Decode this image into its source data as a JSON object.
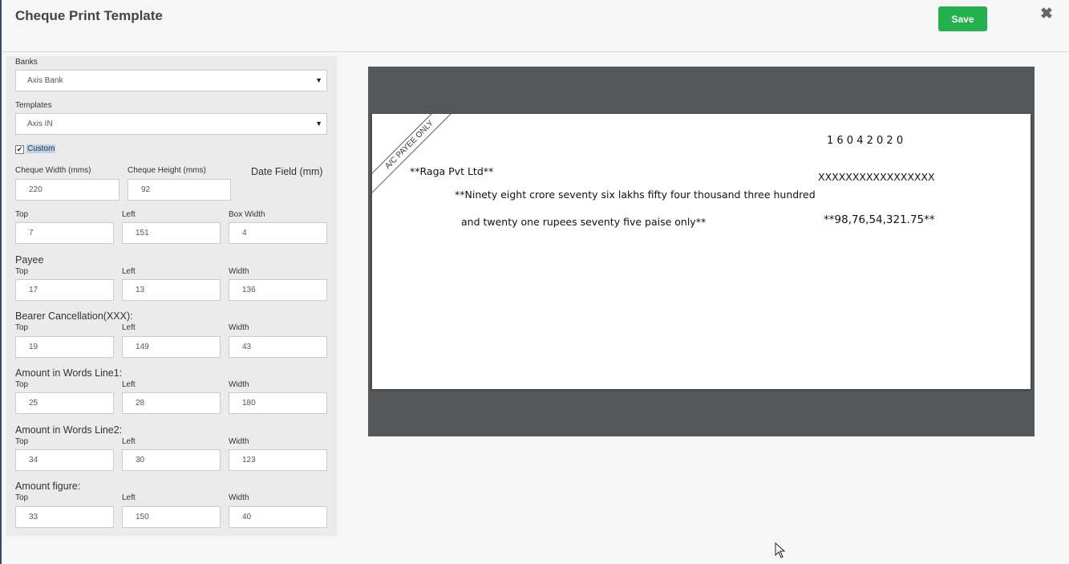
{
  "header": {
    "title": "Cheque Print Template",
    "save_label": "Save",
    "close_icon": "✖"
  },
  "form": {
    "banks_label": "Banks",
    "bank_value": "Axis Bank",
    "templates_label": "Templates",
    "template_value": "Axis IN",
    "custom_label": "Custom",
    "custom_checked": true,
    "width_label": "Cheque Width (mms)",
    "width_value": "220",
    "height_label": "Cheque Height (mms)",
    "height_value": "92",
    "date_heading": "Date Field (mm)",
    "date": {
      "top_label": "Top",
      "top": "7",
      "left_label": "Left",
      "left": "151",
      "box_label": "Box Width",
      "box": "4"
    },
    "payee": {
      "heading": "Payee",
      "top_label": "Top",
      "top": "17",
      "left_label": "Left",
      "left": "13",
      "width_label": "Width",
      "width": "136"
    },
    "bearer": {
      "heading": "Bearer Cancellation(XXX):",
      "top_label": "Top",
      "top": "19",
      "left_label": "Left",
      "left": "149",
      "width_label": "Width",
      "width": "43"
    },
    "words1": {
      "heading": "Amount in Words Line1:",
      "top_label": "Top",
      "top": "25",
      "left_label": "Left",
      "left": "28",
      "width_label": "Width",
      "width": "180"
    },
    "words2": {
      "heading": "Amount in Words Line2:",
      "top_label": "Top",
      "top": "34",
      "left_label": "Left",
      "left": "30",
      "width_label": "Width",
      "width": "123"
    },
    "figure": {
      "heading": "Amount figure:",
      "top_label": "Top",
      "top": "33",
      "left_label": "Left",
      "left": "150",
      "width_label": "Width",
      "width": "40"
    }
  },
  "cheque": {
    "ribbon": "A/C PAYEE ONLY",
    "date": "1 6 0 4 2 0 2 0",
    "payee": "**Raga Pvt Ltd**",
    "bearer": "XXXXXXXXXXXXXXXXX",
    "words_line1": "**Ninety eight crore seventy six lakhs fifty four thousand three hundred",
    "words_line2": "and twenty one rupees seventy five paise only**",
    "amount": "**98,76,54,321.75**"
  },
  "colors": {
    "save": "#22b14c",
    "preview_bg": "#54585b"
  }
}
